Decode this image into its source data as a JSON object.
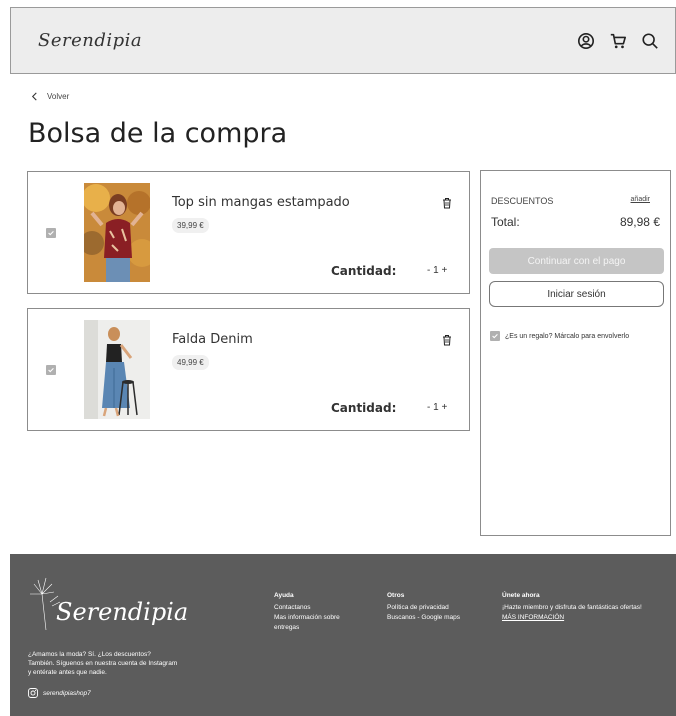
{
  "header": {
    "logo": "Serendipia",
    "icons": [
      "user-icon",
      "cart-icon",
      "search-icon"
    ]
  },
  "nav": {
    "back_label": "Volver"
  },
  "page": {
    "title": "Bolsa de la compra"
  },
  "cart": {
    "quantity_label": "Cantidad:",
    "items": [
      {
        "name": "Top sin mangas estampado",
        "price": "39,99 €",
        "quantity_display": "- 1 +"
      },
      {
        "name": "Falda Denim",
        "price": "49,99 €",
        "quantity_display": "- 1 +"
      }
    ]
  },
  "summary": {
    "discounts_label": "DESCUENTOS",
    "discounts_add": "añadir",
    "total_label": "Total:",
    "total_value": "89,98 €",
    "pay_button": "Continuar con el pago",
    "login_button": "Iniciar sesión",
    "gift_label": "¿Es un regalo? Márcalo para envolverlo"
  },
  "footer": {
    "logo": "Serendipia",
    "about": "¿Amamos la moda? Sí. ¿Los descuentos? También. Síguenos en nuestra cuenta de Instagram  y entérate antes que nadie.",
    "instagram": "serendipiashop7",
    "help": {
      "heading": "Ayuda",
      "links": [
        "Contactanos",
        "Mas información sobre entregas"
      ]
    },
    "others": {
      "heading": "Otros",
      "links": [
        "Política de privacidad",
        "Buscanos - Google maps"
      ]
    },
    "join": {
      "heading": "Únete ahora",
      "text": "¡Hazte miembro y disfruta de fantásticas ofertas!",
      "link": "MÁS INFORMACIÓN"
    }
  },
  "colors": {
    "header_bg": "#ededed",
    "footer_bg": "#5c5c5c",
    "pay_button_bg": "#c5c5c5"
  }
}
